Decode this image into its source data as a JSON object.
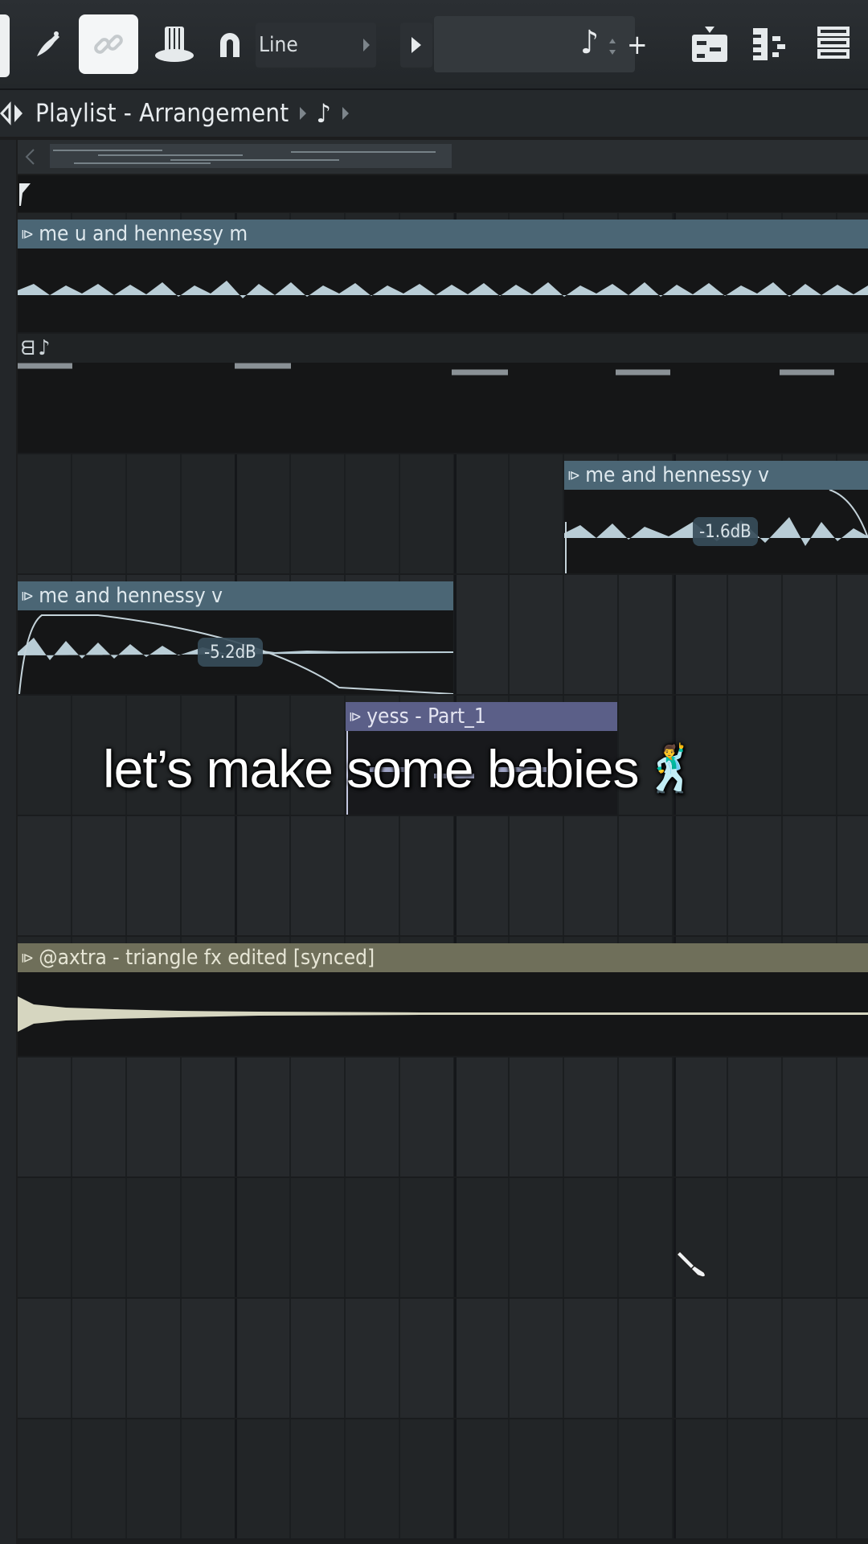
{
  "toolbar": {
    "snap_mode": "Line",
    "icons": [
      "stamp-icon",
      "link-icon",
      "hat-icon",
      "magnet-icon",
      "play-icon",
      "note-icon",
      "plus-icon",
      "pattern-icon",
      "piano-roll-icon",
      "mixer-icon"
    ]
  },
  "playlist": {
    "title": "Playlist - Arrangement",
    "note_glyph": "♪"
  },
  "tracks": [
    {
      "clip": "me u and hennessy m"
    },
    {
      "automation_glyph": "♪"
    },
    {
      "clip": "me and hennessy v",
      "volume": "-1.6dB"
    },
    {
      "clip": "me and hennessy v",
      "volume": "-5.2dB"
    },
    {
      "clip": "yess - Part_1"
    },
    {},
    {
      "clip": "@axtra - triangle fx edited [synced]"
    }
  ],
  "overlay": {
    "caption": "let’s make some babies",
    "emoji": "🕺"
  },
  "colors": {
    "audio_clip": "#4b6675",
    "pattern_clip": "#5b5f88",
    "fx_clip": "#6f6f5a",
    "waveform": "#b9cdd6",
    "background": "#1c1d1e"
  }
}
